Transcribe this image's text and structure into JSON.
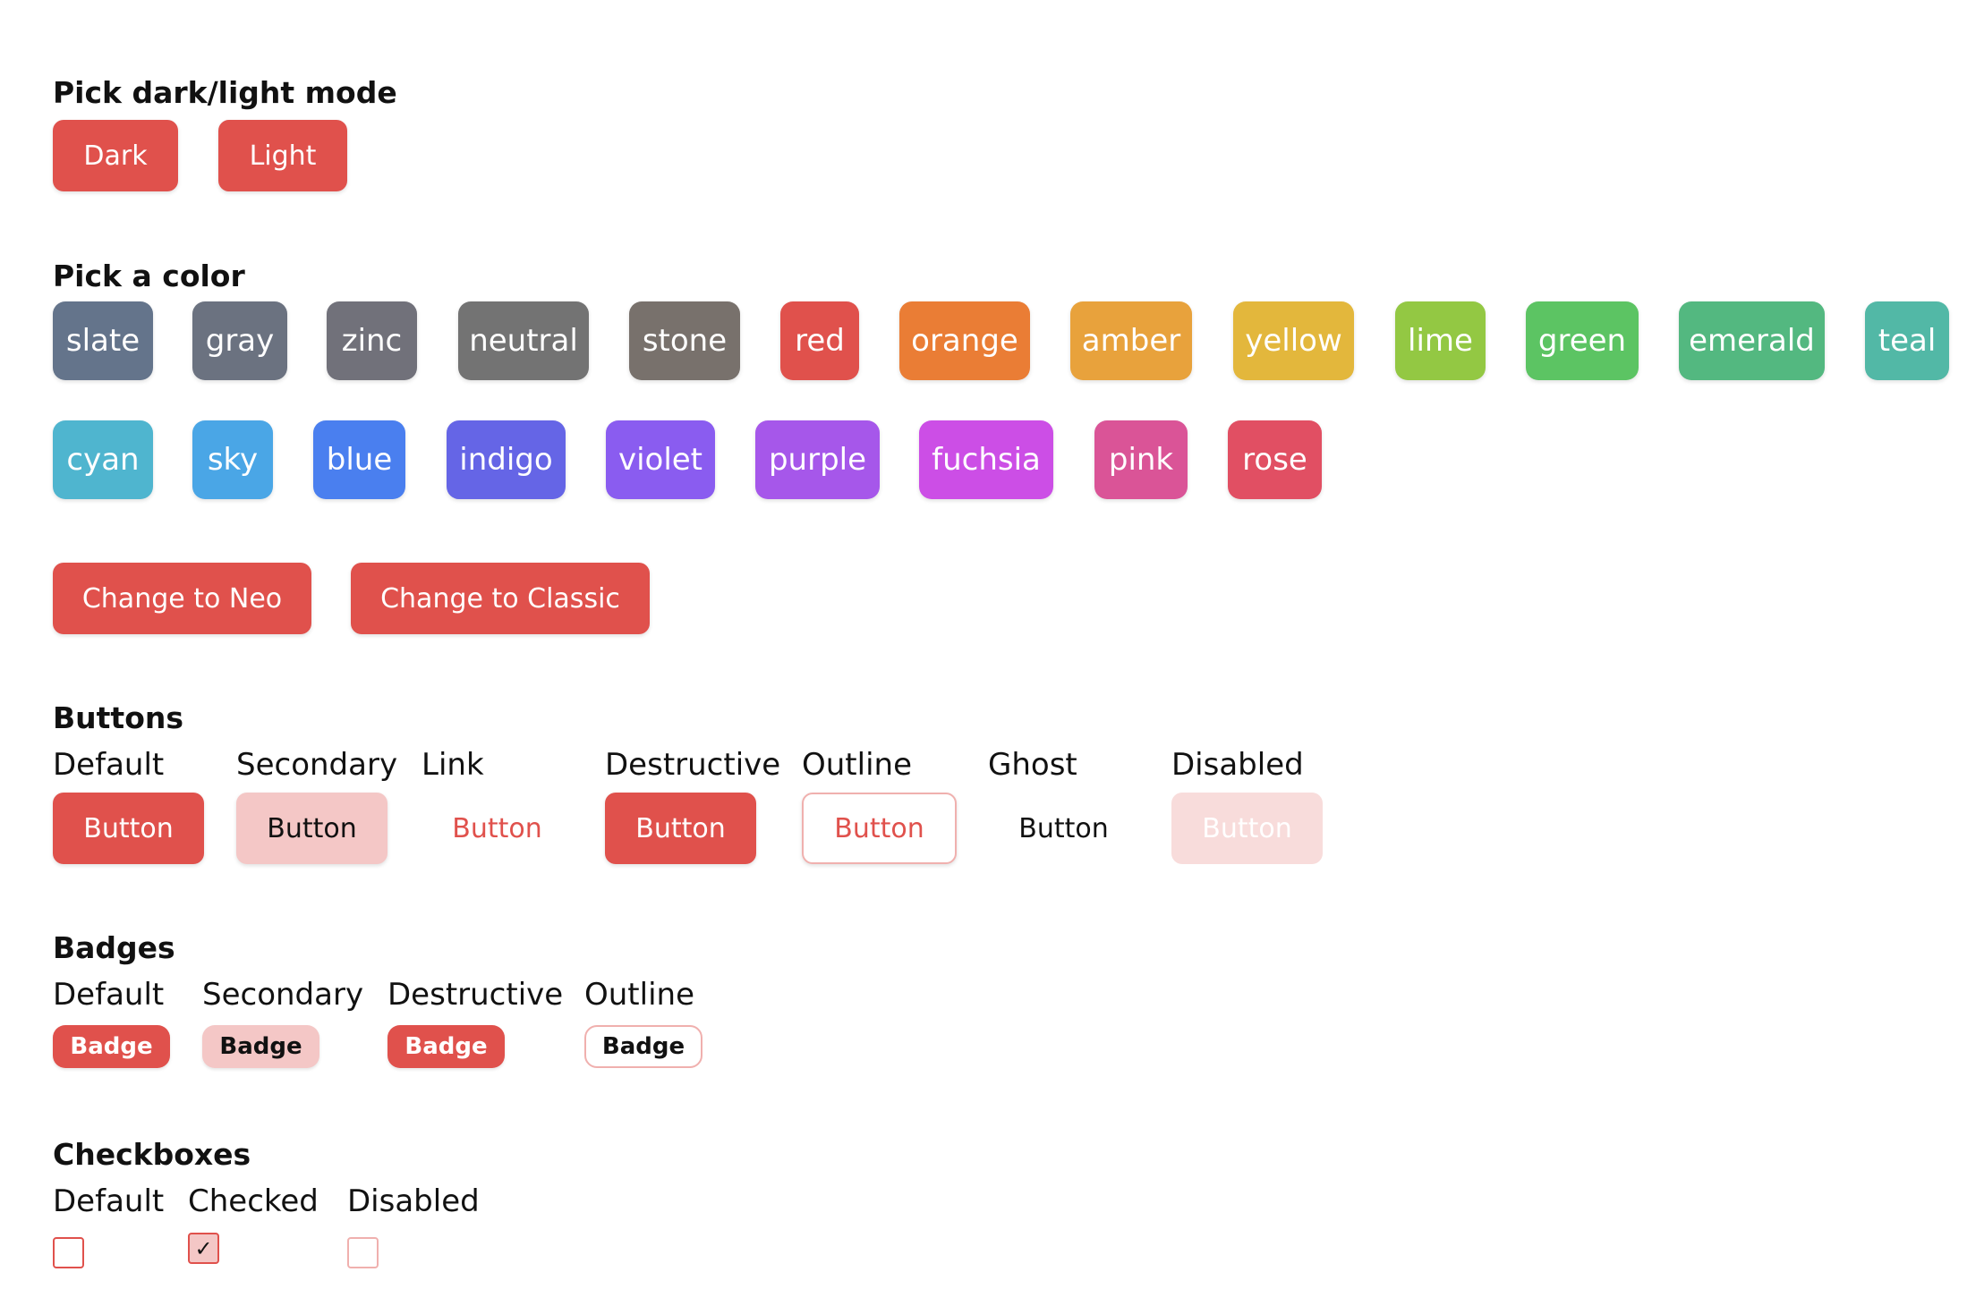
{
  "mode_section": {
    "title": "Pick dark/light mode",
    "buttons": [
      "Dark",
      "Light"
    ]
  },
  "color_section": {
    "title": "Pick a color",
    "colors": [
      {
        "name": "slate",
        "hex": "#64748b"
      },
      {
        "name": "gray",
        "hex": "#6b7280"
      },
      {
        "name": "zinc",
        "hex": "#71717a"
      },
      {
        "name": "neutral",
        "hex": "#737373"
      },
      {
        "name": "stone",
        "hex": "#78716c"
      },
      {
        "name": "red",
        "hex": "#e0514c"
      },
      {
        "name": "orange",
        "hex": "#ea7d35"
      },
      {
        "name": "amber",
        "hex": "#e8a23c"
      },
      {
        "name": "yellow",
        "hex": "#e3b73c"
      },
      {
        "name": "lime",
        "hex": "#93c843"
      },
      {
        "name": "green",
        "hex": "#5cc463"
      },
      {
        "name": "emerald",
        "hex": "#53b880"
      },
      {
        "name": "teal",
        "hex": "#52b8a6"
      },
      {
        "name": "cyan",
        "hex": "#4fb5cf"
      },
      {
        "name": "sky",
        "hex": "#4aa6e6"
      },
      {
        "name": "blue",
        "hex": "#4a7fef"
      },
      {
        "name": "indigo",
        "hex": "#6565e6"
      },
      {
        "name": "violet",
        "hex": "#8a5cf0"
      },
      {
        "name": "purple",
        "hex": "#a657ea"
      },
      {
        "name": "fuchsia",
        "hex": "#cc4ee6"
      },
      {
        "name": "pink",
        "hex": "#da5497"
      },
      {
        "name": "rose",
        "hex": "#e14f63"
      }
    ]
  },
  "style_buttons": {
    "neo": "Change to Neo",
    "classic": "Change to Classic"
  },
  "buttons_section": {
    "title": "Buttons",
    "variants": [
      {
        "label": "Default",
        "button": "Button"
      },
      {
        "label": "Secondary",
        "button": "Button"
      },
      {
        "label": "Link",
        "button": "Button"
      },
      {
        "label": "Destructive",
        "button": "Button"
      },
      {
        "label": "Outline",
        "button": "Button"
      },
      {
        "label": "Ghost",
        "button": "Button"
      },
      {
        "label": "Disabled",
        "button": "Button"
      }
    ]
  },
  "badges_section": {
    "title": "Badges",
    "variants": [
      {
        "label": "Default",
        "badge": "Badge"
      },
      {
        "label": "Secondary",
        "badge": "Badge"
      },
      {
        "label": "Destructive",
        "badge": "Badge"
      },
      {
        "label": "Outline",
        "badge": "Badge"
      }
    ]
  },
  "checkboxes_section": {
    "title": "Checkboxes",
    "items": [
      {
        "label": "Default",
        "checked": false,
        "disabled": false
      },
      {
        "label": "Checked",
        "checked": true,
        "disabled": false,
        "check_glyph": "✓"
      },
      {
        "label": "Disabled",
        "checked": false,
        "disabled": true
      }
    ]
  },
  "accent_color": "#e0514c"
}
